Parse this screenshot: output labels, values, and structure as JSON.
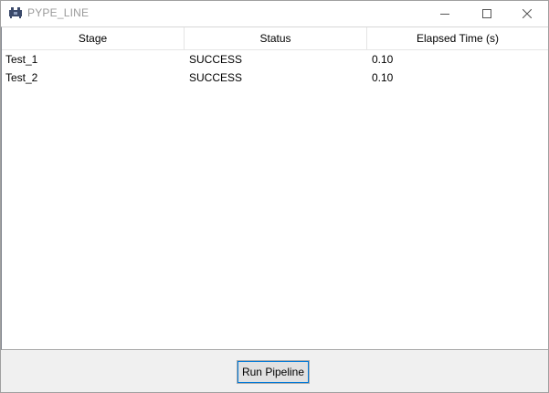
{
  "window": {
    "title": "PYPE_LINE",
    "icon": "app-pipeline-icon"
  },
  "titlebar_buttons": {
    "minimize": "minimize-icon",
    "maximize": "maximize-icon",
    "close": "close-icon"
  },
  "table": {
    "columns": [
      "Stage",
      "Status",
      "Elapsed Time (s)"
    ],
    "rows": [
      {
        "stage": "Test_1",
        "status": "SUCCESS",
        "elapsed": "0.10"
      },
      {
        "stage": "Test_2",
        "status": "SUCCESS",
        "elapsed": "0.10"
      }
    ]
  },
  "footer": {
    "run_label": "Run Pipeline"
  }
}
